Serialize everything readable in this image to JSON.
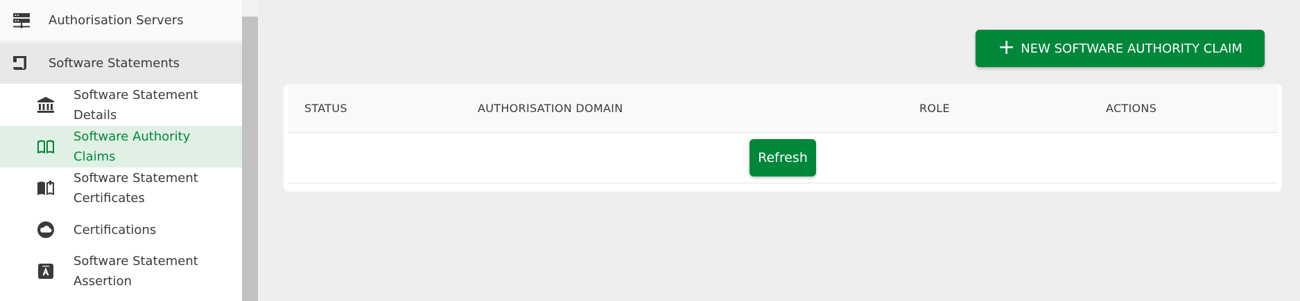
{
  "sidebar": {
    "top_items": [
      {
        "label": "Authorisation Servers",
        "icon": "server-icon"
      },
      {
        "label": "Software Statements",
        "icon": "document-icon"
      }
    ],
    "sub_items": [
      {
        "label": "Software Statement Details",
        "icon": "bank-icon",
        "active": false
      },
      {
        "label": "Software Authority Claims",
        "icon": "open-book-icon",
        "active": true
      },
      {
        "label": "Software Statement Certificates",
        "icon": "book-icon",
        "active": false
      },
      {
        "label": "Certifications",
        "icon": "cloud-icon",
        "active": false
      },
      {
        "label": "Software Statement Assertion",
        "icon": "assertion-badge-icon",
        "active": false
      }
    ]
  },
  "toolbar": {
    "new_claim_plus": "+",
    "new_claim_label": "NEW SOFTWARE AUTHORITY CLAIM"
  },
  "table": {
    "columns": [
      "STATUS",
      "AUTHORISATION DOMAIN",
      "ROLE",
      "ACTIONS"
    ],
    "refresh_label": "Refresh"
  },
  "colors": {
    "accent": "#00873a",
    "active_bg": "#e0f0e4",
    "page_bg": "#eeeeee"
  }
}
